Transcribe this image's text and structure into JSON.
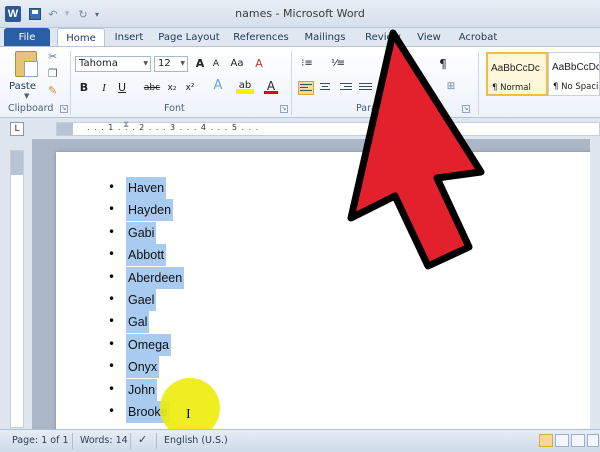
{
  "window": {
    "title": "names - Microsoft Word",
    "app_logo": "W"
  },
  "quick_access": {
    "icons": [
      "save-icon",
      "undo-icon",
      "redo-icon",
      "customize-icon"
    ]
  },
  "tabs": [
    "File",
    "Home",
    "Insert",
    "Page Layout",
    "References",
    "Mailings",
    "Review",
    "View",
    "Acrobat"
  ],
  "ribbon": {
    "clipboard": {
      "paste_label": "Paste",
      "group_label": "Clipboard"
    },
    "font": {
      "name": "Tahoma",
      "size": "12",
      "group_label": "Font",
      "bold": "B",
      "italic": "I",
      "underline": "U",
      "strikethrough": "abc",
      "subscript": "x₂",
      "superscript": "x²",
      "grow": "A",
      "shrink": "A",
      "case": "Aa",
      "clear": "A",
      "effects": "A",
      "highlight": "ab",
      "color": "A"
    },
    "paragraph": {
      "group_label": "Para",
      "pilcrow": "¶"
    },
    "styles": [
      {
        "sample": "AaBbCcDc",
        "name": "¶ Normal"
      },
      {
        "sample": "AaBbCcDc",
        "name": "¶ No Spaci..."
      }
    ]
  },
  "ruler": {
    "tab_symbol": "L",
    "numbers": ". . . 1 . . . 2 . . . 3 . . . 4 . . . 5 . . ."
  },
  "document": {
    "bullet": "•",
    "names": [
      "Haven",
      "Hayden",
      "Gabi",
      "Abbott",
      "Aberdeen",
      "Gael",
      "Gal",
      "Omega",
      "Onyx",
      "John",
      "Brooke"
    ]
  },
  "status": {
    "page": "Page: 1 of 1",
    "words": "Words: 14",
    "language": "English (U.S.)"
  },
  "colors": {
    "selection": "#a8cbef",
    "arrow": "#e3212d",
    "highlight_circle": "#ecec0a",
    "file_tab": "#2a5fa8"
  }
}
